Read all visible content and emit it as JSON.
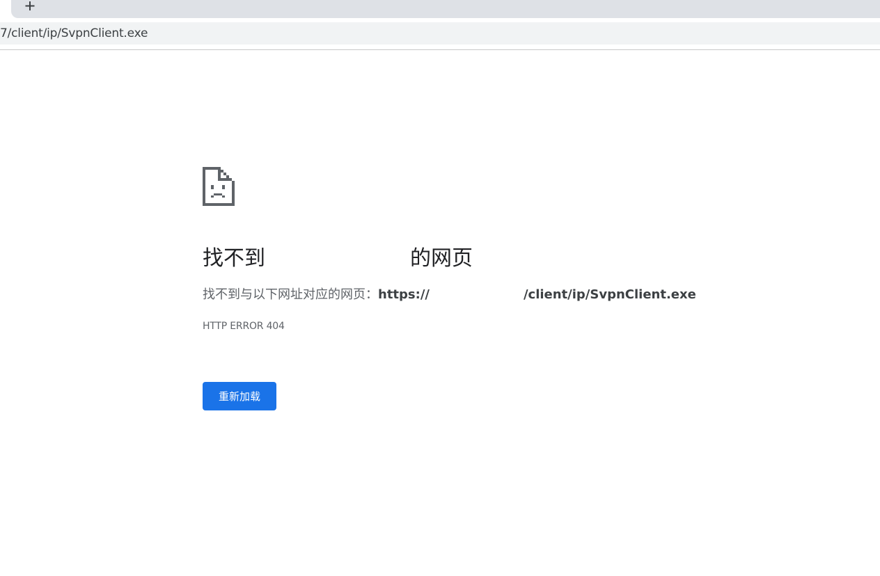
{
  "browser": {
    "new_tab_icon": "plus-icon",
    "address": "7/client/ip/SvpnClient.exe"
  },
  "error_page": {
    "icon": "sad-page-icon",
    "headline_prefix": "找不到",
    "headline_suffix": "的网页",
    "description_prefix": "找不到与以下网址对应的网页：",
    "url_start": "https://",
    "url_end": "/client/ip/SvpnClient.exe",
    "error_code": "HTTP ERROR 404",
    "reload_label": "重新加载"
  },
  "colors": {
    "accent": "#1a73e8",
    "tabstrip": "#dee1e6",
    "omnibox": "#f1f3f4",
    "icon": "#5f6368"
  }
}
